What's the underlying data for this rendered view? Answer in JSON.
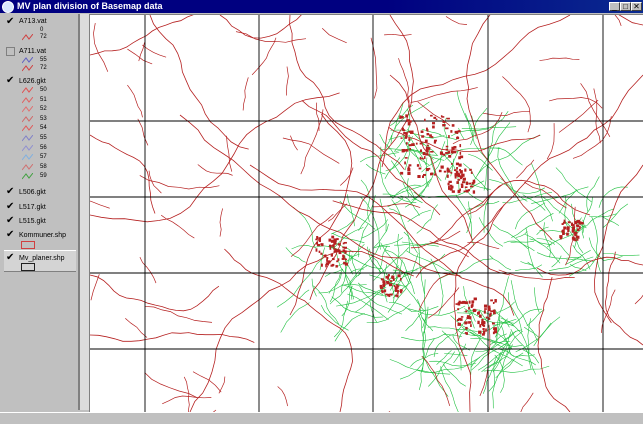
{
  "window": {
    "title": "MV plan division of Basemap data",
    "icon": "app-globe-icon"
  },
  "window_buttons": [
    "_",
    "□",
    "✕"
  ],
  "toc": {
    "layers": [
      {
        "name": "A713.vat",
        "checked": true,
        "classes": [
          {
            "label": "0",
            "color": ""
          },
          {
            "label": "72",
            "color": "#d04040"
          }
        ]
      },
      {
        "name": "A711.vat",
        "checked": false,
        "classes": [
          {
            "label": "55",
            "color": "#6060c0"
          },
          {
            "label": "72",
            "color": "#d04040"
          }
        ]
      },
      {
        "name": "L626.gkt",
        "checked": true,
        "classes": [
          {
            "label": "50",
            "color": "#e05050"
          },
          {
            "label": "51",
            "color": "#e06060"
          },
          {
            "label": "52",
            "color": "#e07070"
          },
          {
            "label": "53",
            "color": "#d06868"
          },
          {
            "label": "54",
            "color": "#e05a5a"
          },
          {
            "label": "55",
            "color": "#8080c8"
          },
          {
            "label": "56",
            "color": "#9090d0"
          },
          {
            "label": "57",
            "color": "#80b0e0"
          },
          {
            "label": "58",
            "color": "#d07070"
          },
          {
            "label": "59",
            "color": "#40a040"
          }
        ]
      },
      {
        "name": "L506.gkt",
        "checked": true,
        "classes": []
      },
      {
        "name": "L517.gkt",
        "checked": true,
        "classes": []
      },
      {
        "name": "L515.gkt",
        "checked": true,
        "classes": []
      },
      {
        "name": "Kommuner.shp",
        "checked": true,
        "swatch": "#d04040",
        "classes": []
      },
      {
        "name": "Mv_planer.shp",
        "checked": true,
        "swatch": "#202020",
        "classes": []
      }
    ]
  },
  "colors": {
    "roads": "#b52020",
    "urban": "#20c040",
    "grid": "#000000",
    "titlebar": "#000080"
  }
}
